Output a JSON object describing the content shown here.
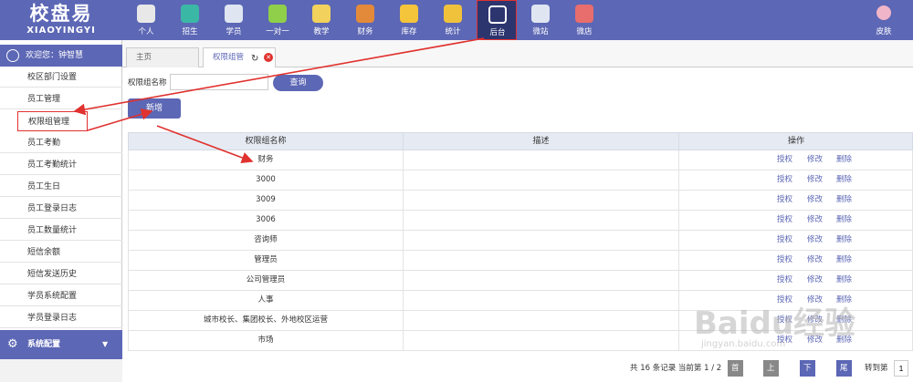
{
  "logo": {
    "cn": "校盘易",
    "en": "XIAOYINGYI"
  },
  "nav": [
    {
      "label": "个人",
      "icon": "person-icon",
      "color": "#e8e8e8"
    },
    {
      "label": "招生",
      "icon": "search-icon",
      "color": "#3bb7a6"
    },
    {
      "label": "学员",
      "icon": "student-card-icon",
      "color": "#dfe6f2"
    },
    {
      "label": "一对一",
      "icon": "chat-icon",
      "color": "#8fcf4a"
    },
    {
      "label": "教学",
      "icon": "pencil-icon",
      "color": "#f2d15c"
    },
    {
      "label": "财务",
      "icon": "briefcase-icon",
      "color": "#e38a3a"
    },
    {
      "label": "库存",
      "icon": "pie-chart-icon",
      "color": "#f4c43b"
    },
    {
      "label": "统计",
      "icon": "bar-chart-icon",
      "color": "#f0c23c"
    },
    {
      "label": "后台",
      "icon": "monitor-icon",
      "color": "#ffffff",
      "active": true
    },
    {
      "label": "微站",
      "icon": "browser-icon",
      "color": "#dfe6f2"
    },
    {
      "label": "微店",
      "icon": "shop-icon",
      "color": "#e86d6d"
    }
  ],
  "skin": {
    "label": "皮肤"
  },
  "sidebar": {
    "welcome": "欢迎您：钟智慧",
    "items": [
      {
        "label": "校区部门设置"
      },
      {
        "label": "员工管理"
      },
      {
        "label": "权限组管理",
        "selected": true
      },
      {
        "label": "员工考勤"
      },
      {
        "label": "员工考勤统计"
      },
      {
        "label": "员工生日"
      },
      {
        "label": "员工登录日志"
      },
      {
        "label": "员工数量统计"
      },
      {
        "label": "短信余额"
      },
      {
        "label": "短信发送历史"
      },
      {
        "label": "学员系统配置"
      },
      {
        "label": "学员登录日志"
      }
    ],
    "config": "系统配置"
  },
  "tabs": [
    {
      "label": "主页"
    },
    {
      "label": "权限组管"
    }
  ],
  "search": {
    "label": "权限组名称",
    "value": "",
    "query": "查询",
    "add": "新增"
  },
  "table": {
    "headers": [
      "权限组名称",
      "描述",
      "操作"
    ],
    "actions": [
      "授权",
      "修改",
      "删除"
    ],
    "rows": [
      {
        "name": "财务",
        "desc": ""
      },
      {
        "name": "3000",
        "desc": ""
      },
      {
        "name": "3009",
        "desc": ""
      },
      {
        "name": "3006",
        "desc": ""
      },
      {
        "name": "咨询师",
        "desc": ""
      },
      {
        "name": "管理员",
        "desc": ""
      },
      {
        "name": "公司管理员",
        "desc": ""
      },
      {
        "name": "人事",
        "desc": ""
      },
      {
        "name": "城市校长、集团校长、外地校区运营",
        "desc": ""
      },
      {
        "name": "市场",
        "desc": ""
      }
    ]
  },
  "pager": {
    "info": "共 16 条记录 当前第 1 / 2",
    "first": "首页",
    "prev": "上一页",
    "next": "下一页",
    "last": "尾页",
    "goto": "转到第",
    "page": "1"
  },
  "watermark": {
    "text": "Baidu经验",
    "sub": "jingyan.baidu.com"
  },
  "colors": {
    "brand": "#5c67b5",
    "annotation": "#e0322f"
  }
}
